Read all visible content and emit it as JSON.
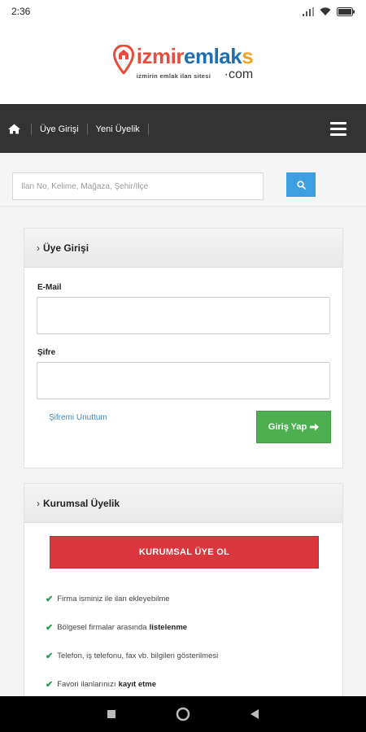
{
  "status_bar": {
    "time": "2:36"
  },
  "logo": {
    "part_izmir": "izmir",
    "part_emlak": "emlak",
    "part_s": "s",
    "tagline": "izmirin emlak ilan sitesi",
    "domain": "·com"
  },
  "navbar": {
    "home_icon": "home-icon",
    "login_link": "Üye Girişi",
    "register_link": "Yeni Üyelik",
    "menu_icon": "hamburger-icon"
  },
  "search": {
    "placeholder": "İlan No, Kelime, Mağaza, Şehir/İlçe",
    "button_icon": "search-icon"
  },
  "login_panel": {
    "title": "Üye Girişi",
    "email_label": "E-Mail",
    "email_value": "",
    "password_label": "Şifre",
    "password_value": "",
    "forgot_link": "Şifremi Unuttum",
    "submit_label": "Giriş Yap"
  },
  "corporate_panel": {
    "title": "Kurumsal Üyelik",
    "button_label": "KURUMSAL ÜYE OL",
    "benefits": [
      {
        "text": "Firma isminiz ile ilan ekleyebilme",
        "bold": ""
      },
      {
        "text": "Bölgesel firmalar arasında",
        "bold": "listelenme"
      },
      {
        "text": "Telefon, iş telefonu, fax vb. bilgileri gösterilmesi",
        "bold": ""
      },
      {
        "text": "Favori ilanlarınızı",
        "bold": "kayıt etme"
      }
    ]
  },
  "colors": {
    "navbar": "#333333",
    "search_button": "#3b9fe0",
    "login_button": "#4caf50",
    "corporate_button": "#d9363e",
    "check": "#1f9a4b"
  }
}
